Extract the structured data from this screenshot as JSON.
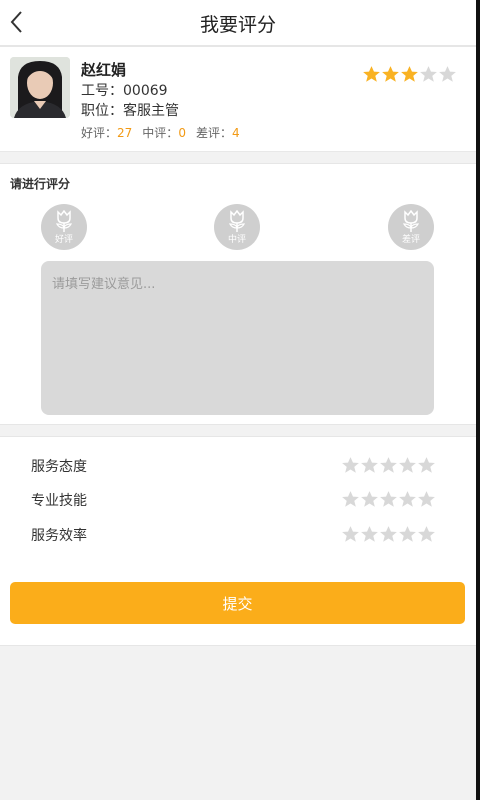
{
  "header": {
    "title": "我要评分"
  },
  "profile": {
    "name": "赵红娟",
    "employee_id": "工号：00069",
    "position": "职位：客服主管",
    "good_label": "好评：",
    "good_count": "27",
    "neutral_label": "中评：",
    "neutral_count": "0",
    "bad_label": "差评：",
    "bad_count": "4",
    "rating": 3,
    "rating_max": 5
  },
  "rating_section": {
    "title": "请进行评分",
    "options": [
      {
        "label": "好评",
        "selected": true,
        "icon": "flower-icon"
      },
      {
        "label": "中评",
        "selected": false,
        "icon": "flower-icon"
      },
      {
        "label": "差评",
        "selected": false,
        "icon": "flower-icon"
      }
    ],
    "comment_placeholder": "请填写建议意见...",
    "comment_value": ""
  },
  "criteria": [
    {
      "label": "服务态度",
      "rating": 0,
      "max": 5
    },
    {
      "label": "专业技能",
      "rating": 0,
      "max": 5
    },
    {
      "label": "服务效率",
      "rating": 0,
      "max": 5
    }
  ],
  "submit_label": "提交",
  "colors": {
    "accent": "#fbad1a",
    "star_active": "#f9b223",
    "star_inactive": "#d8d8d8",
    "count_number": "#f29a15"
  }
}
